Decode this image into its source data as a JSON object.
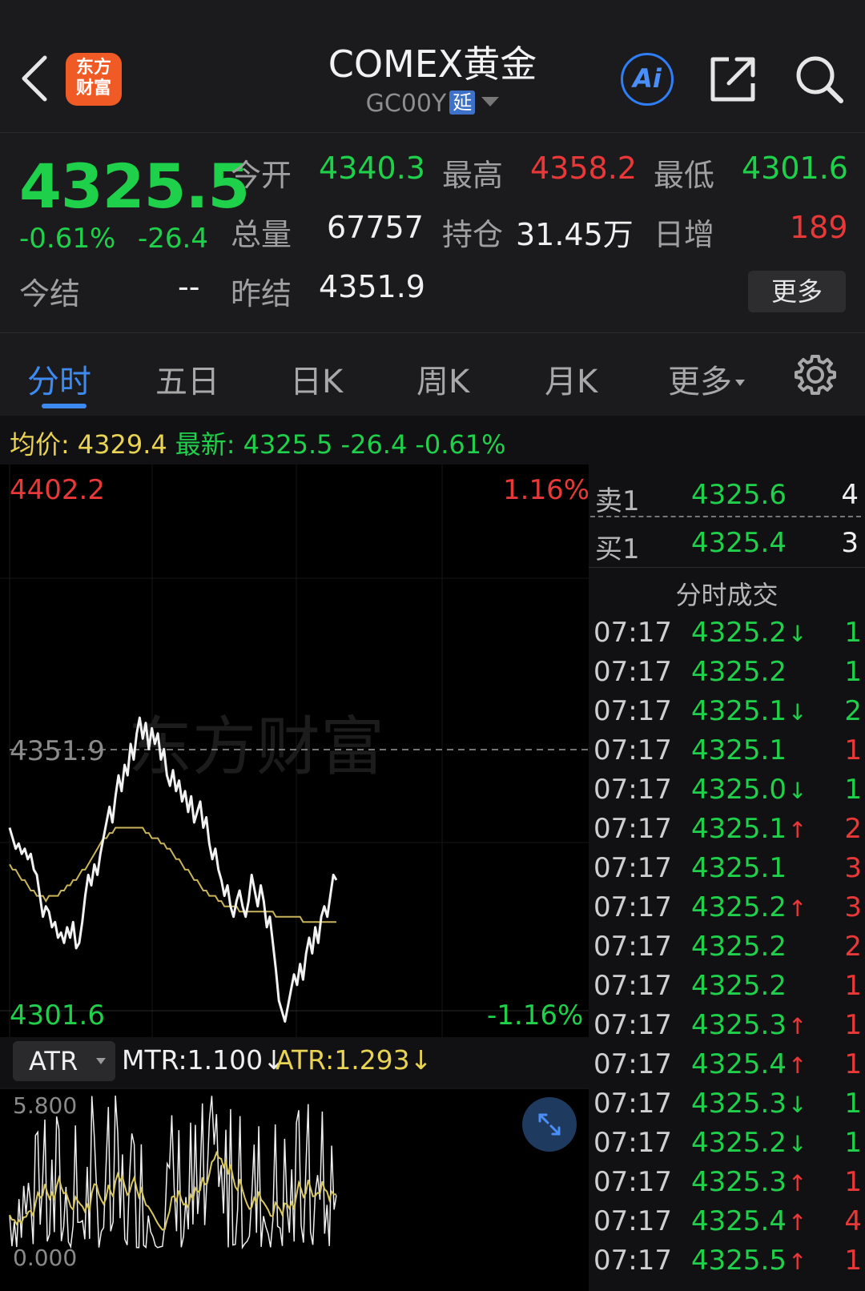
{
  "header": {
    "logo_line1": "东方",
    "logo_line2": "财富",
    "title": "COMEX黄金",
    "code": "GC00Y",
    "delay_badge": "延",
    "ai_label": "Ai"
  },
  "quote": {
    "last_price": "4325.5",
    "change_pct": "-0.61%",
    "change_abs": "-26.4",
    "open_label": "今开",
    "open": "4340.3",
    "high_label": "最高",
    "high": "4358.2",
    "low_label": "最低",
    "low": "4301.6",
    "volume_label": "总量",
    "volume": "67757",
    "oi_label": "持仓",
    "oi": "31.45万",
    "daily_inc_label": "日增",
    "daily_inc": "189",
    "settle_label": "今结",
    "settle": "--",
    "prev_settle_label": "昨结",
    "prev_settle": "4351.9",
    "more_label": "更多"
  },
  "tabs": {
    "items": [
      "分时",
      "五日",
      "日K",
      "周K",
      "月K",
      "更多"
    ],
    "active": "分时"
  },
  "info_line": {
    "avg_label": "均价:",
    "avg": "4329.4",
    "latest_label": "最新:",
    "latest": "4325.5",
    "chg": "-26.4",
    "pct": "-0.61%"
  },
  "chart_labels": {
    "y_top": "4402.2",
    "pct_top": "1.16%",
    "y_mid": "4351.9",
    "y_bottom": "4301.6",
    "pct_bottom": "-1.16%",
    "watermark": "东方财富"
  },
  "chart_data": {
    "type": "line",
    "ylim": [
      4301.6,
      4402.2
    ],
    "reference": 4351.9,
    "series": [
      {
        "values": [
          4335,
          4333,
          4331,
          4332,
          4330,
          4331,
          4329,
          4330,
          4327,
          4326,
          4322,
          4318,
          4320,
          4319,
          4316,
          4317,
          4314,
          4315,
          4313,
          4316,
          4314,
          4317,
          4312,
          4313,
          4317,
          4322,
          4326,
          4324,
          4328,
          4326,
          4330,
          4333,
          4336,
          4339,
          4336,
          4341,
          4345,
          4342,
          4347,
          4345,
          4351,
          4348,
          4353,
          4356,
          4352,
          4355,
          4350,
          4354,
          4351,
          4353,
          4348,
          4350,
          4345,
          4343,
          4346,
          4342,
          4344,
          4340,
          4342,
          4338,
          4341,
          4336,
          4338,
          4340,
          4335,
          4337,
          4332,
          4329,
          4331,
          4327,
          4325,
          4322,
          4324,
          4320,
          4318,
          4321,
          4323,
          4320,
          4318,
          4321,
          4326,
          4323,
          4320,
          4324,
          4321,
          4316,
          4318,
          4313,
          4308,
          4302,
          4300,
          4298,
          4301,
          4304,
          4307,
          4305,
          4309,
          4306,
          4311,
          4314,
          4311,
          4316,
          4313,
          4318,
          4320,
          4318,
          4322,
          4326,
          4325
        ]
      },
      {
        "values": [
          4328,
          4327,
          4327,
          4326,
          4325,
          4325,
          4324,
          4323,
          4323,
          4322,
          4322,
          4322,
          4321,
          4322,
          4322,
          4322,
          4322,
          4323,
          4323,
          4324,
          4324,
          4325,
          4325,
          4326,
          4327,
          4327,
          4328,
          4329,
          4330,
          4331,
          4332,
          4333,
          4333,
          4334,
          4334,
          4335,
          4335,
          4335,
          4335,
          4335,
          4335,
          4335,
          4335,
          4335,
          4335,
          4334,
          4334,
          4333,
          4333,
          4333,
          4332,
          4332,
          4331,
          4331,
          4330,
          4329,
          4329,
          4328,
          4327,
          4327,
          4326,
          4325,
          4325,
          4324,
          4323,
          4323,
          4322,
          4322,
          4322,
          4321,
          4321,
          4320,
          4320,
          4320,
          4320,
          4320,
          4319,
          4319,
          4319,
          4319,
          4319,
          4319,
          4319,
          4319,
          4319,
          4319,
          4319,
          4319,
          4318,
          4318,
          4318,
          4318,
          4318,
          4318,
          4318,
          4318,
          4318,
          4317,
          4317,
          4317,
          4317,
          4317,
          4317,
          4317,
          4317,
          4317,
          4317,
          4317,
          4317
        ]
      }
    ]
  },
  "indicator": {
    "name": "ATR",
    "mtr": "MTR:1.100",
    "mtr_arrow": "↓",
    "atr": "ATR:1.293",
    "atr_arrow": "↓",
    "y_top": "5.800",
    "y_bottom": "0.000"
  },
  "order_book": {
    "ask_label": "卖1",
    "ask_price": "4325.6",
    "ask_vol": "4",
    "bid_label": "买1",
    "bid_price": "4325.4",
    "bid_vol": "3"
  },
  "time_trades": {
    "title": "分时成交",
    "rows": [
      {
        "time": "07:17",
        "price": "4325.2",
        "arrow": "↓",
        "vol": "1",
        "dir": "down"
      },
      {
        "time": "07:17",
        "price": "4325.2",
        "arrow": "",
        "vol": "1",
        "dir": "down"
      },
      {
        "time": "07:17",
        "price": "4325.1",
        "arrow": "↓",
        "vol": "2",
        "dir": "down"
      },
      {
        "time": "07:17",
        "price": "4325.1",
        "arrow": "",
        "vol": "1",
        "dir": "up"
      },
      {
        "time": "07:17",
        "price": "4325.0",
        "arrow": "↓",
        "vol": "1",
        "dir": "down"
      },
      {
        "time": "07:17",
        "price": "4325.1",
        "arrow": "↑",
        "vol": "2",
        "dir": "up"
      },
      {
        "time": "07:17",
        "price": "4325.1",
        "arrow": "",
        "vol": "3",
        "dir": "up"
      },
      {
        "time": "07:17",
        "price": "4325.2",
        "arrow": "↑",
        "vol": "3",
        "dir": "up"
      },
      {
        "time": "07:17",
        "price": "4325.2",
        "arrow": "",
        "vol": "2",
        "dir": "up"
      },
      {
        "time": "07:17",
        "price": "4325.2",
        "arrow": "",
        "vol": "1",
        "dir": "up"
      },
      {
        "time": "07:17",
        "price": "4325.3",
        "arrow": "↑",
        "vol": "1",
        "dir": "up"
      },
      {
        "time": "07:17",
        "price": "4325.4",
        "arrow": "↑",
        "vol": "1",
        "dir": "up"
      },
      {
        "time": "07:17",
        "price": "4325.3",
        "arrow": "↓",
        "vol": "1",
        "dir": "down"
      },
      {
        "time": "07:17",
        "price": "4325.2",
        "arrow": "↓",
        "vol": "1",
        "dir": "down"
      },
      {
        "time": "07:17",
        "price": "4325.3",
        "arrow": "↑",
        "vol": "1",
        "dir": "up"
      },
      {
        "time": "07:17",
        "price": "4325.4",
        "arrow": "↑",
        "vol": "4",
        "dir": "up"
      },
      {
        "time": "07:17",
        "price": "4325.5",
        "arrow": "↑",
        "vol": "1",
        "dir": "up"
      }
    ]
  },
  "colors": {
    "up": "#e93838",
    "down": "#1fd14a",
    "accent": "#3d8bf0",
    "avg_line": "#c9b45a"
  }
}
